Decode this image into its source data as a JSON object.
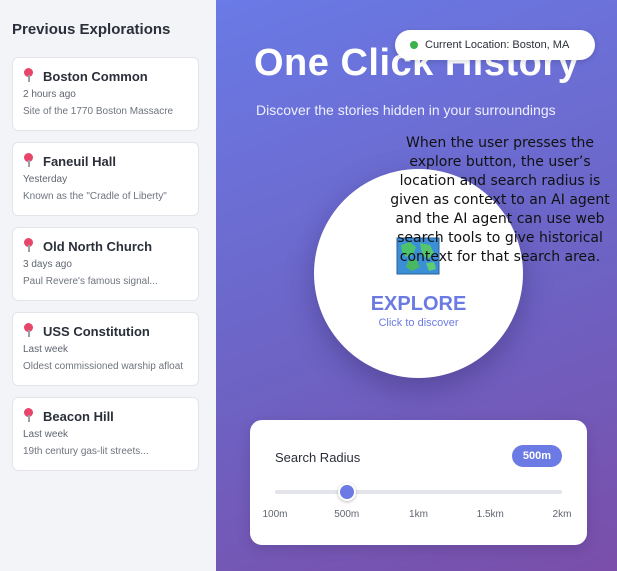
{
  "sidebar": {
    "title": "Previous Explorations",
    "items": [
      {
        "name": "Boston Common",
        "time": "2 hours ago",
        "desc": "Site of the 1770 Boston Massacre",
        "icon": "pin-icon"
      },
      {
        "name": "Faneuil Hall",
        "time": "Yesterday",
        "desc": "Known as the \"Cradle of Liberty\"",
        "icon": "pin-icon"
      },
      {
        "name": "Old North Church",
        "time": "3 days ago",
        "desc": "Paul Revere's famous signal...",
        "icon": "pin-icon"
      },
      {
        "name": "USS Constitution",
        "time": "Last week",
        "desc": "Oldest commissioned warship afloat",
        "icon": "pin-icon"
      },
      {
        "name": "Beacon Hill",
        "time": "Last week",
        "desc": "19th century gas-lit streets...",
        "icon": "pin-icon"
      }
    ]
  },
  "location": {
    "text": "Current Location: Boston, MA",
    "status_color": "#3cb04a"
  },
  "header": {
    "title": "One Click History",
    "subtitle": "Discover the stories hidden in your surroundings"
  },
  "explore": {
    "label": "EXPLORE",
    "sublabel": "Click to discover",
    "icon": "map-icon"
  },
  "annotation": "When the user presses the explore button, the user’s location and search radius is given as context to an AI agent and the AI agent can use web search tools to give historical context for that search area.",
  "radius": {
    "label": "Search Radius",
    "value": "500m",
    "ticks": [
      "100m",
      "500m",
      "1km",
      "1.5km",
      "2km"
    ],
    "selected_index": 1
  },
  "colors": {
    "accent": "#6c7be3",
    "pin": "#e8456b",
    "gradient_start": "#6a7ae6",
    "gradient_end": "#7a4eaa"
  }
}
